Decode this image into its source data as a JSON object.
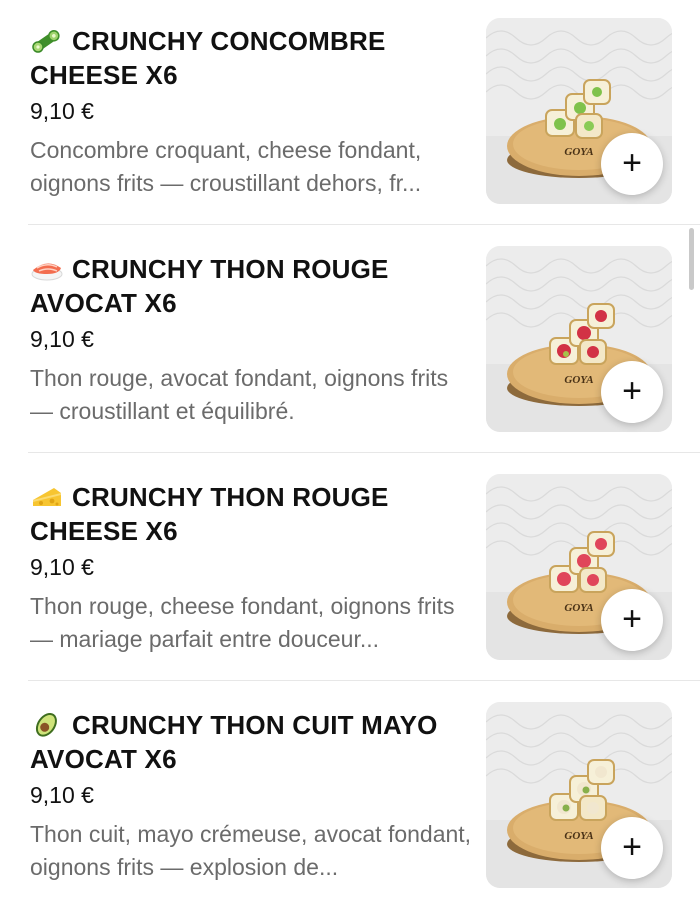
{
  "items": [
    {
      "emoji": "cucumber-icon",
      "title": "CRUNCHY CONCOMBRE CHEESE X6",
      "price": "9,10 €",
      "description": "Concombre croquant, cheese fondant, oignons frits — croustillant dehors, fr...",
      "brand_mark": "GOYA",
      "add_label": "+"
    },
    {
      "emoji": "sushi-icon",
      "title": "CRUNCHY THON ROUGE AVOCAT X6",
      "price": "9,10 €",
      "description": "Thon rouge, avocat fondant, oignons frits — croustillant et équilibré.",
      "brand_mark": "GOYA",
      "add_label": "+"
    },
    {
      "emoji": "cheese-icon",
      "title": "CRUNCHY THON ROUGE CHEESE X6",
      "price": "9,10 €",
      "description": "Thon rouge, cheese fondant, oignons frits — mariage parfait entre douceur...",
      "brand_mark": "GOYA",
      "add_label": "+"
    },
    {
      "emoji": "avocado-icon",
      "title": "CRUNCHY THON CUIT MAYO AVOCAT X6",
      "price": "9,10 €",
      "description": "Thon cuit, mayo crémeuse, avocat fondant, oignons frits — explosion de...",
      "brand_mark": "GOYA",
      "add_label": "+"
    }
  ]
}
